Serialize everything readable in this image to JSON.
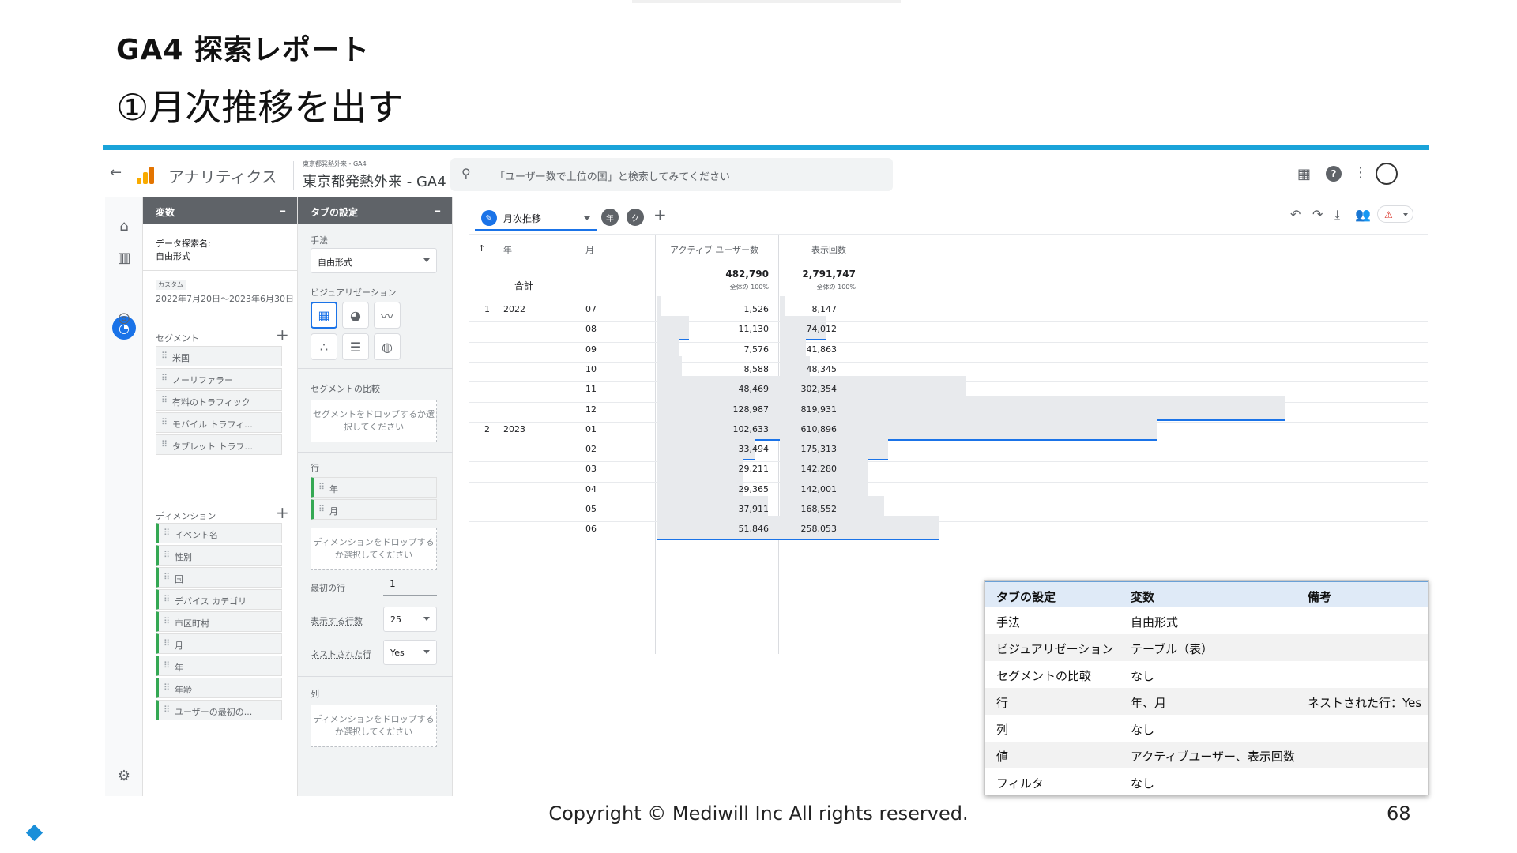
{
  "slide": {
    "title": "GA4 探索レポート",
    "subtitle": "①月次推移を出す",
    "copyright": "Copyright © Mediwill Inc All rights reserved.",
    "page": "68"
  },
  "app": {
    "name": "アナリティクス",
    "property_small": "東京都発熱外来 - GA4",
    "property": "東京都発熱外来 - GA4",
    "search_placeholder": "「ユーザー数で上位の国」と検索してみてください"
  },
  "colors": {
    "accent": "#1a73e8",
    "rule": "#1aa3d9",
    "dimension": "#34a853",
    "bar": "#e8eaed"
  },
  "variables": {
    "header": "変数",
    "exploration_label": "データ探索名:",
    "exploration_name": "自由形式",
    "custom": "カスタム",
    "date_range": "2022年7月20日～2023年6月30日",
    "segments_label": "セグメント",
    "segments": [
      "米国",
      "ノーリファラー",
      "有料のトラフィック",
      "モバイル トラフィ...",
      "タブレット トラフ..."
    ],
    "dimensions_label": "ディメンション",
    "dimensions": [
      "イベント名",
      "性別",
      "国",
      "デバイス カテゴリ",
      "市区町村",
      "月",
      "年",
      "年齢",
      "ユーザーの最初の..."
    ]
  },
  "tab": {
    "header": "タブの設定",
    "method_label": "手法",
    "method": "自由形式",
    "viz_label": "ビジュアリゼーション",
    "seg_compare_label": "セグメントの比較",
    "drop_segment": "セグメントをドロップするか選択してください",
    "rows_label": "行",
    "rows": [
      "年",
      "月"
    ],
    "drop_dimension": "ディメンションをドロップするか選択してください",
    "first_row_label": "最初の行",
    "first_row": "1",
    "rows_shown_label": "表示する行数",
    "rows_shown": "25",
    "nested_label": "ネストされた行",
    "nested": "Yes",
    "cols_label": "列",
    "drop_dimension2": "ディメンションをドロップするか選択してください"
  },
  "report": {
    "tab_name": "月次推移",
    "headers": {
      "year": "年",
      "month": "月",
      "users": "アクティブ ユーザー数",
      "views": "表示回数"
    },
    "total_label": "合計",
    "total_users": "482,790",
    "total_users_pct": "全体の 100%",
    "total_views": "2,791,747",
    "total_views_pct": "全体の 100%",
    "rows": [
      {
        "idx": "1",
        "year": "2022",
        "month": "07",
        "users": "1,526",
        "views": "8,147",
        "u": 1526,
        "v": 8147
      },
      {
        "idx": "",
        "year": "",
        "month": "08",
        "users": "11,130",
        "views": "74,012",
        "u": 11130,
        "v": 74012
      },
      {
        "idx": "",
        "year": "",
        "month": "09",
        "users": "7,576",
        "views": "41,863",
        "u": 7576,
        "v": 41863
      },
      {
        "idx": "",
        "year": "",
        "month": "10",
        "users": "8,588",
        "views": "48,345",
        "u": 8588,
        "v": 48345
      },
      {
        "idx": "",
        "year": "",
        "month": "11",
        "users": "48,469",
        "views": "302,354",
        "u": 48469,
        "v": 302354
      },
      {
        "idx": "",
        "year": "",
        "month": "12",
        "users": "128,987",
        "views": "819,931",
        "u": 128987,
        "v": 819931
      },
      {
        "idx": "2",
        "year": "2023",
        "month": "01",
        "users": "102,633",
        "views": "610,896",
        "u": 102633,
        "v": 610896
      },
      {
        "idx": "",
        "year": "",
        "month": "02",
        "users": "33,494",
        "views": "175,313",
        "u": 33494,
        "v": 175313
      },
      {
        "idx": "",
        "year": "",
        "month": "03",
        "users": "29,211",
        "views": "142,280",
        "u": 29211,
        "v": 142280
      },
      {
        "idx": "",
        "year": "",
        "month": "04",
        "users": "29,365",
        "views": "142,001",
        "u": 29365,
        "v": 142001
      },
      {
        "idx": "",
        "year": "",
        "month": "05",
        "users": "37,911",
        "views": "168,552",
        "u": 37911,
        "v": 168552
      },
      {
        "idx": "",
        "year": "",
        "month": "06",
        "users": "51,846",
        "views": "258,053",
        "u": 51846,
        "v": 258053
      }
    ]
  },
  "notes": {
    "headers": [
      "タブの設定",
      "変数",
      "備考"
    ],
    "rows": [
      [
        "手法",
        "自由形式",
        ""
      ],
      [
        "ビジュアリゼーション",
        "テーブル（表）",
        ""
      ],
      [
        "セグメントの比較",
        "なし",
        ""
      ],
      [
        "行",
        "年、月",
        "ネストされた行：Yes"
      ],
      [
        "列",
        "なし",
        ""
      ],
      [
        "値",
        "アクティブユーザー、表示回数",
        ""
      ],
      [
        "フィルタ",
        "なし",
        ""
      ]
    ]
  }
}
